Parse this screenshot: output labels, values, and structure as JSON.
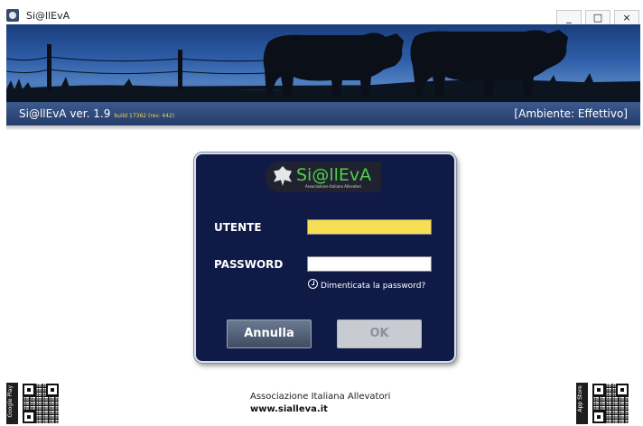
{
  "window": {
    "title": "Si@llEvA",
    "minimize_glyph": "_",
    "maximize_glyph": "□",
    "close_glyph": "×"
  },
  "banner": {
    "version_text": "Si@llEvA ver. 1.9",
    "build_text": "build 17362 (rev. 442)",
    "environment_text": "[Ambiente: Effettivo]"
  },
  "login": {
    "logo_text": "Si@llEvA",
    "logo_subtitle": "Associazione Italiana Allevatori",
    "username_label": "UTENTE",
    "username_value": "",
    "password_label": "PASSWORD",
    "password_value": "",
    "forgot_link": "Dimenticata la password?",
    "cancel_label": "Annulla",
    "ok_label": "OK"
  },
  "footer": {
    "organization": "Associazione Italiana Allevatori",
    "website": "www.sialleva.it",
    "left_store": "Google Play",
    "right_store": "App Store"
  },
  "colors": {
    "banner_blue": "#2e5ea8",
    "login_background": "#0f1a47",
    "username_field": "#f7df55",
    "logo_green": "#4fd24a",
    "build_text": "#ffd542"
  }
}
